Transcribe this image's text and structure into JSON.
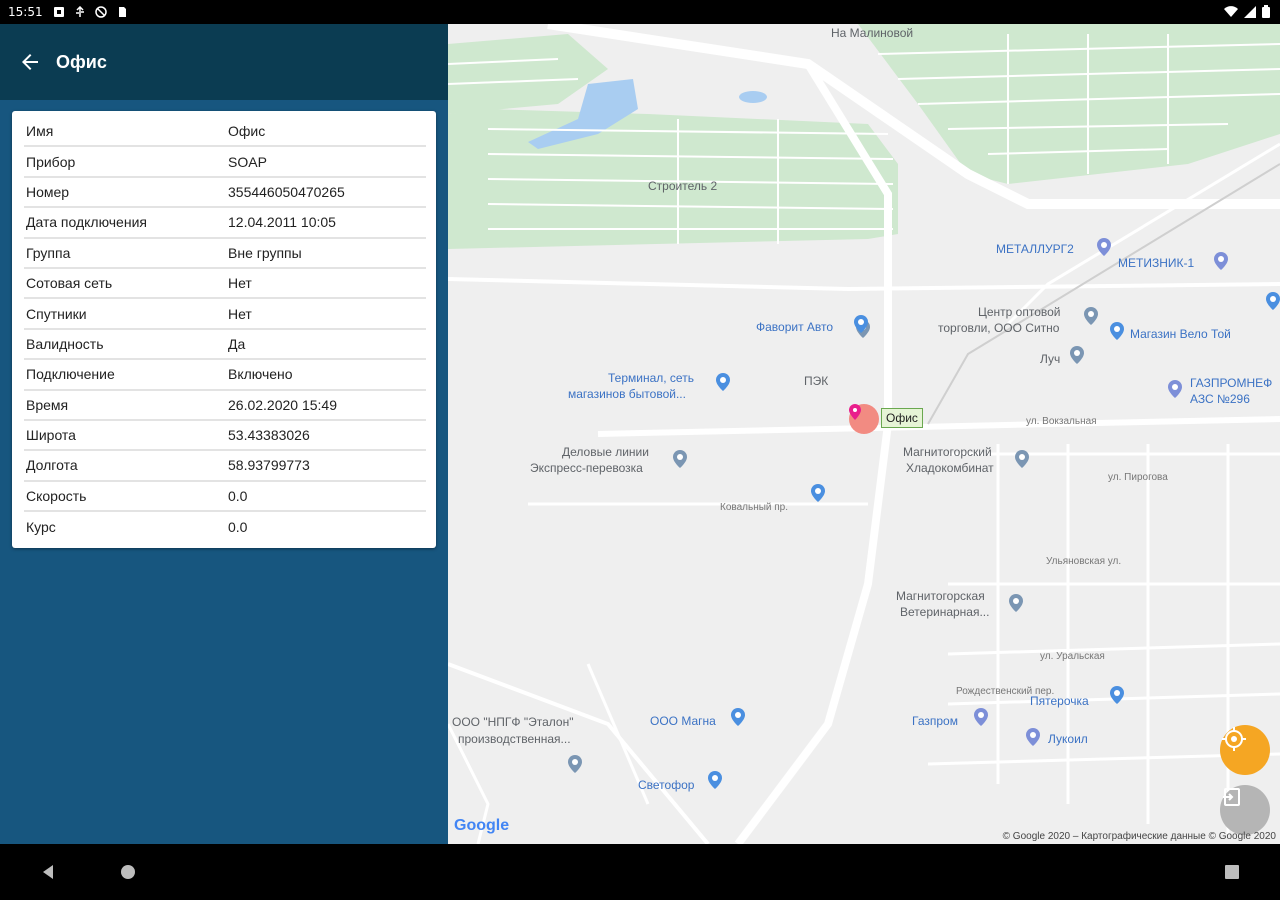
{
  "status_bar": {
    "time": "15:51"
  },
  "app_bar": {
    "title": "Офис"
  },
  "details": [
    {
      "key": "Имя",
      "value": "Офис"
    },
    {
      "key": "Прибор",
      "value": "SOAP"
    },
    {
      "key": "Номер",
      "value": "355446050470265"
    },
    {
      "key": "Дата подключения",
      "value": "12.04.2011 10:05"
    },
    {
      "key": "Группа",
      "value": "Вне группы"
    },
    {
      "key": "Сотовая сеть",
      "value": "Нет"
    },
    {
      "key": "Спутники",
      "value": "Нет"
    },
    {
      "key": "Валидность",
      "value": "Да"
    },
    {
      "key": "Подключение",
      "value": "Включено"
    },
    {
      "key": "Время",
      "value": "26.02.2020 15:49"
    },
    {
      "key": "Широта",
      "value": "53.43383026"
    },
    {
      "key": "Долгота",
      "value": "58.93799773"
    },
    {
      "key": "Скорость",
      "value": "0.0"
    },
    {
      "key": "Курс",
      "value": "0.0"
    }
  ],
  "map": {
    "marker_label": "Офис",
    "labels": {
      "na_malinovoy": "На Малиновой",
      "stroitel2": "Строитель 2",
      "metallurg2": "МЕТАЛЛУРГ2",
      "metiznik1": "МЕТИЗНИК-1",
      "favorit": "Фаворит Авто",
      "center1": "Центр оптовой",
      "center2": "торговли, ООО Ситно",
      "velo": "Магазин Вело Той",
      "luch": "Луч",
      "pek": "ПЭК",
      "terminal1": "Терминал, сеть",
      "terminal2": "магазинов бытовой...",
      "gazprom1": "ГАЗПРОМНЕФ",
      "gazprom2": "АЗС №296",
      "vokzalnaya": "ул. Вокзальная",
      "delovye1": "Деловые линии",
      "delovye2": "Экспресс-перевозка",
      "kladkomb1": "Магнитогорский",
      "kladkomb2": "Хладокомбинат",
      "pirogova": "ул. Пирогова",
      "kovalnyi": "Ковальный пр.",
      "vet1": "Магнитогорская",
      "vet2": "Ветеринарная...",
      "ulyanovskaya": "Ульяновская ул.",
      "uralskaya": "ул. Уральская",
      "etalon1": "ООО \"НПГФ \"Эталон\"",
      "etalon2": "производственная...",
      "magna": "ООО Магна",
      "gazprom": "Газпром",
      "pyaterochka": "Пятерочка",
      "lukoil": "Лукоил",
      "svetofor": "Светофор",
      "rozhd": "Рождественский пер."
    },
    "google": "Google",
    "copyright": "© Google 2020 – Картографические данные © Google 2020"
  }
}
